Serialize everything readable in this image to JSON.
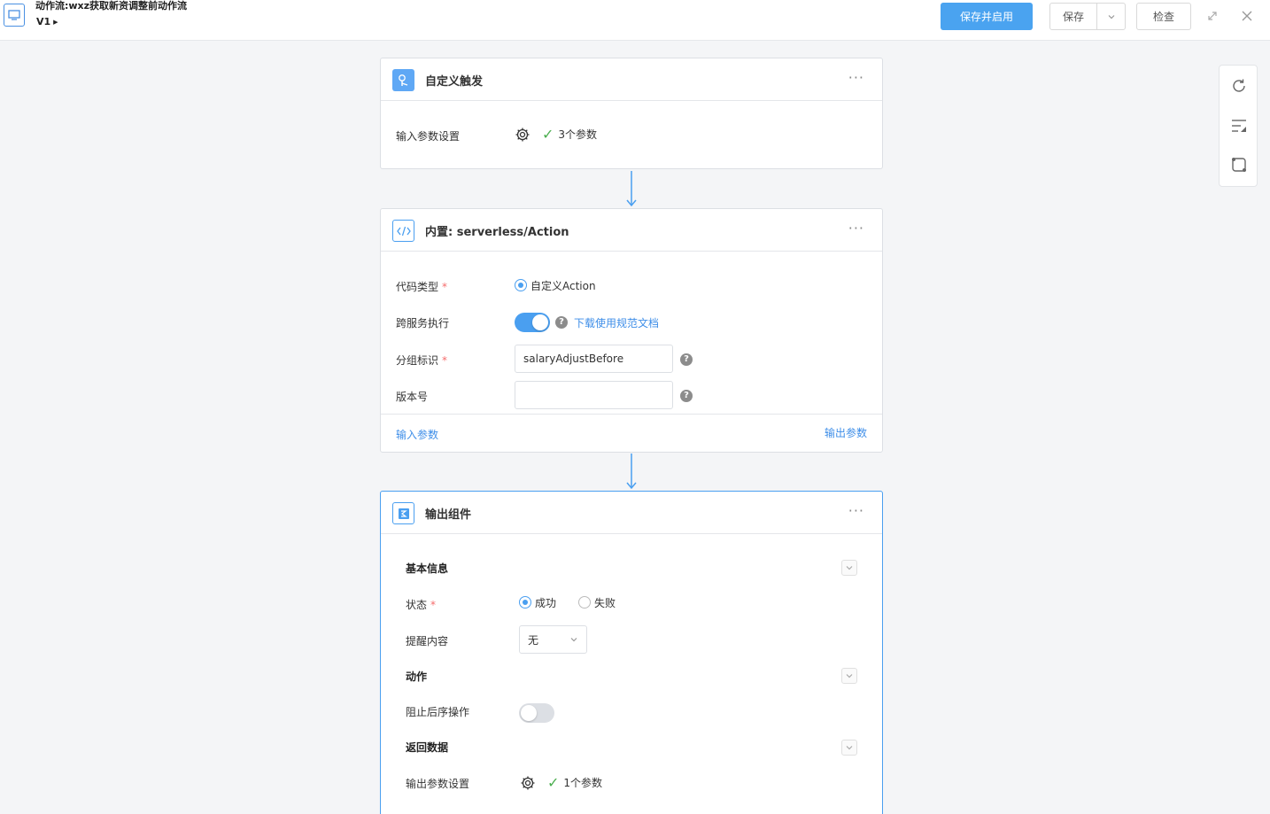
{
  "header": {
    "title": "动作流:wxz获取新资调整前动作流",
    "version": "V1",
    "save_enable_label": "保存并启用",
    "save_label": "保存",
    "check_label": "检查"
  },
  "trigger": {
    "title": "自定义触发",
    "more": "···",
    "param_label": "输入参数设置",
    "param_count": "3个参数"
  },
  "action": {
    "title": "内置: serverless/Action",
    "more": "···",
    "code_type_label": "代码类型",
    "code_type_value": "自定义Action",
    "cross_service_label": "跨服务执行",
    "cross_service_on": true,
    "doc_link": "下载使用规范文档",
    "group_label": "分组标识",
    "group_value": "salaryAdjustBefore",
    "version_label": "版本号",
    "version_value": "",
    "input_params_link": "输入参数",
    "output_params_link": "输出参数"
  },
  "output": {
    "title": "输出组件",
    "more": "···",
    "basic_info": "基本信息",
    "status_label": "状态",
    "status_success": "成功",
    "status_fail": "失败",
    "reminder_label": "提醒内容",
    "reminder_value": "无",
    "action_section": "动作",
    "block_label": "阻止后序操作",
    "block_on": false,
    "return_section": "返回数据",
    "output_param_label": "输出参数设置",
    "output_param_count": "1个参数"
  },
  "colors": {
    "primary": "#4aa3f0",
    "link": "#3e8ee8",
    "required": "#f56c6c",
    "check": "#4caf50"
  }
}
